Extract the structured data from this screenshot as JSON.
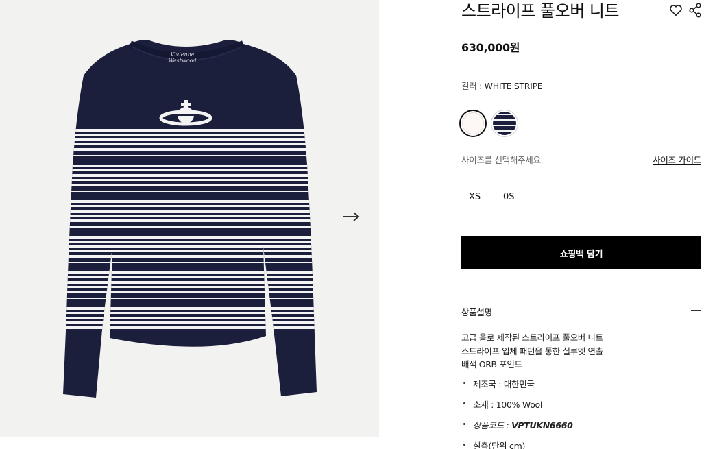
{
  "product": {
    "title": "스트라이프 풀오버 니트",
    "price": "630,000원",
    "image_brand_tag": [
      "Vivienne",
      "Westwood"
    ]
  },
  "color": {
    "label": "컬러 : ",
    "selected": "WHITE STRIPE",
    "swatches": [
      "white",
      "navy-stripe"
    ]
  },
  "size": {
    "prompt": "사이즈를 선택해주세요.",
    "guide_label": "사이즈 가이드",
    "options": [
      "XS",
      "0S"
    ]
  },
  "cart_button": "쇼핑백 담기",
  "description": {
    "heading": "상품설명",
    "lines": [
      "고급 울로 제작된 스트라이프 풀오버 니트",
      "스트라이프 입체 패턴을 통한 실루엣 연출",
      "배색 ORB 포인트"
    ],
    "bullets": [
      "제조국 : 대한민국",
      "소재 : 100% Wool",
      "상품코드 : ",
      "실측(단위 cm)"
    ],
    "product_code": "VPTUKN6660"
  },
  "colors": {
    "navy": "#1b1f3b",
    "stripe_white": "#f4f4f4",
    "background": "#f2f2f0",
    "button": "#000000"
  },
  "icons": [
    "heart-icon",
    "share-icon",
    "arrow-right-icon",
    "minus-icon"
  ]
}
